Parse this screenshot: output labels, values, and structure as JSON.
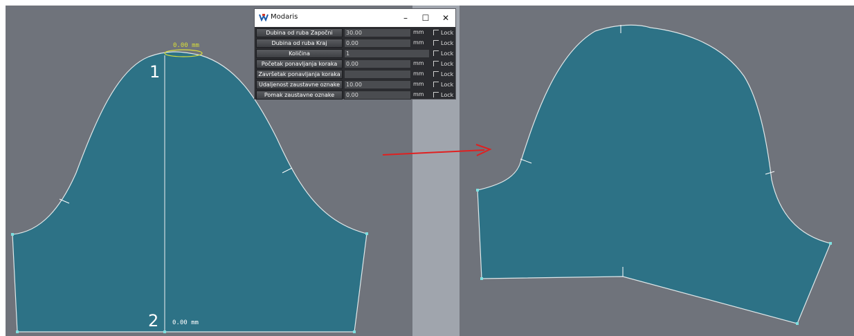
{
  "canvas": {
    "left_number_top": "1",
    "left_number_bottom": "2",
    "left_top_measure": "0.00 mm",
    "left_bottom_measure": "0.00 mm",
    "piece_color": "#2d7286",
    "background_color": "#6f737b",
    "divider_color": "#a0a5ad",
    "arrow_color": "#e02020"
  },
  "dialog": {
    "title": "Modaris",
    "minimize_label": "–",
    "maximize_label": "☐",
    "close_label": "✕",
    "rows": [
      {
        "label": "Dubina od ruba Započni",
        "value": "30.00",
        "unit": "mm",
        "lock": "Lock"
      },
      {
        "label": "Dubina od ruba Kraj",
        "value": "0.00",
        "unit": "mm",
        "lock": "Lock"
      },
      {
        "label": "Količina",
        "value": "1",
        "unit": "",
        "lock": "Lock"
      },
      {
        "label": "Početak ponavljanja koraka",
        "value": "0.00",
        "unit": "mm",
        "lock": "Lock"
      },
      {
        "label": "Završetak ponavljanja koraka",
        "value": "",
        "unit": "mm",
        "lock": "Lock"
      },
      {
        "label": "Udaljenost zaustavne oznake",
        "value": "10.00",
        "unit": "mm",
        "lock": "Lock"
      },
      {
        "label": "Pomak zaustavne oznake",
        "value": "0.00",
        "unit": "mm",
        "lock": "Lock"
      }
    ]
  }
}
